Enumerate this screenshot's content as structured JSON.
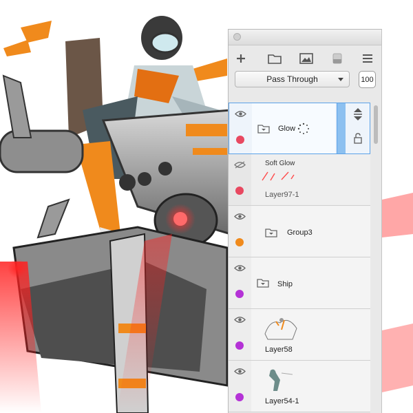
{
  "colors": {
    "accent_selection": "#5aa1e8",
    "tag_red": "#e84860",
    "tag_orange": "#f08a1c",
    "tag_purple": "#b432d6"
  },
  "toolbar": {
    "icons": [
      "plus-icon",
      "folder-icon",
      "image-icon",
      "mask-icon",
      "menu-icon"
    ]
  },
  "blend": {
    "mode": "Pass Through",
    "opacity": "100"
  },
  "layers": [
    {
      "name": "Glow",
      "type": "group",
      "visible": true,
      "color_tag": "red",
      "selected": true
    },
    {
      "name": "Soft Glow",
      "sublabel": "Layer97-1",
      "type": "layer",
      "visible": false,
      "color_tag": "red",
      "selected": false
    },
    {
      "name": "Group3",
      "type": "group",
      "visible": true,
      "color_tag": "orange",
      "selected": false
    },
    {
      "name": "Ship",
      "type": "group",
      "visible": true,
      "color_tag": "purple",
      "selected": false
    },
    {
      "name": "Layer58",
      "type": "layer",
      "visible": true,
      "color_tag": "purple",
      "selected": false
    },
    {
      "name": "Layer54-1",
      "type": "layer",
      "visible": true,
      "color_tag": "purple",
      "selected": false
    }
  ]
}
